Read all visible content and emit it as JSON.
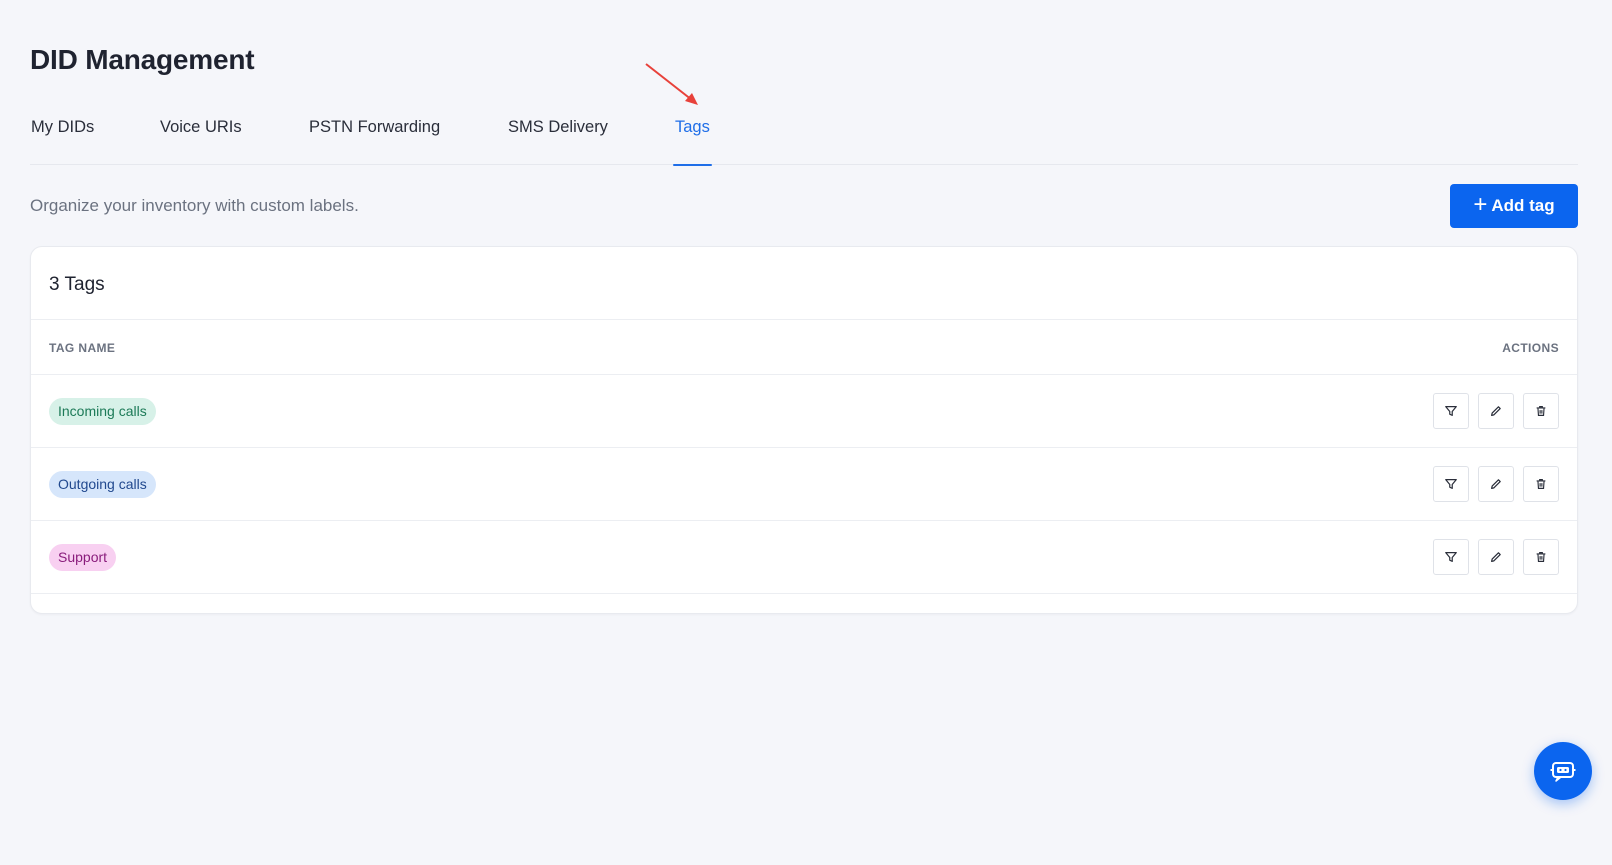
{
  "header": {
    "title": "DID Management"
  },
  "tabs": [
    {
      "label": "My DIDs",
      "active": false
    },
    {
      "label": "Voice URIs",
      "active": false
    },
    {
      "label": "PSTN Forwarding",
      "active": false
    },
    {
      "label": "SMS Delivery",
      "active": false
    },
    {
      "label": "Tags",
      "active": true
    }
  ],
  "toolbar": {
    "subtitle": "Organize your inventory with custom labels.",
    "add_label": "Add tag",
    "add_icon": "plus-icon"
  },
  "table": {
    "count_label": "3 Tags",
    "columns": [
      "TAG NAME",
      "ACTIONS"
    ],
    "rows": [
      {
        "name": "Incoming calls",
        "bg": "#d7f1e8",
        "fg": "#1c7a57"
      },
      {
        "name": "Outgoing calls",
        "bg": "#d6e6fb",
        "fg": "#21498f"
      },
      {
        "name": "Support",
        "bg": "#f8d0f1",
        "fg": "#8a1c7c"
      }
    ],
    "row_actions": [
      "filter-icon",
      "pencil-icon",
      "trash-icon"
    ]
  },
  "colors": {
    "accent": "#0b65ef",
    "tab_active": "#1f6ee8",
    "annotation_arrow": "#e8413a"
  },
  "chat": {
    "icon": "chat-bot-icon"
  }
}
